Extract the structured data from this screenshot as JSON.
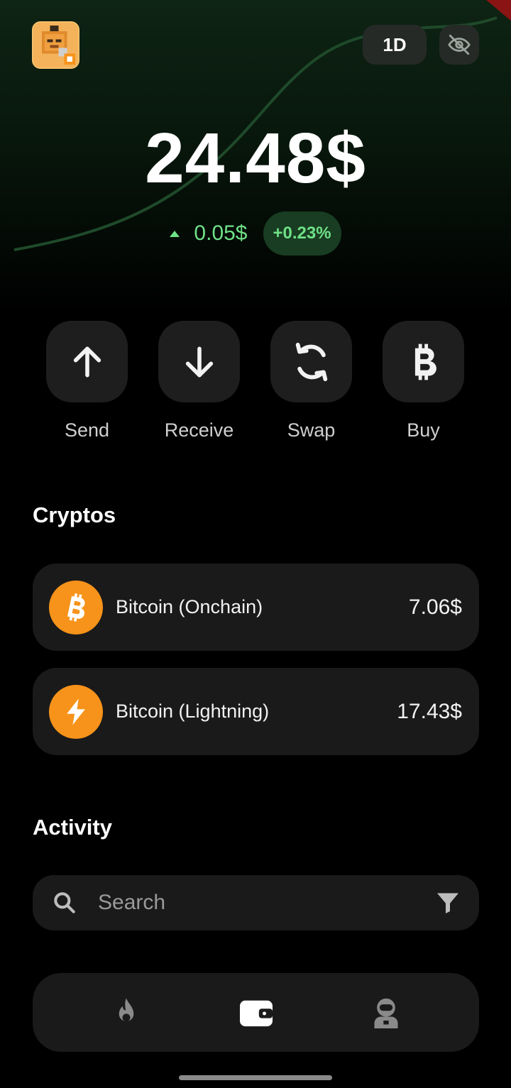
{
  "header": {
    "period_label": "1D",
    "avatar_icon": "pixel-mascot-avatar",
    "visibility_icon": "eye-off-icon"
  },
  "balance": {
    "total": "24.48$",
    "change_amount": "0.05$",
    "change_percent": "+0.23%",
    "change_direction_icon": "triangle-up-icon"
  },
  "actions": [
    {
      "label": "Send",
      "icon": "arrow-up-icon"
    },
    {
      "label": "Receive",
      "icon": "arrow-down-icon"
    },
    {
      "label": "Swap",
      "icon": "swap-icon"
    },
    {
      "label": "Buy",
      "icon": "bitcoin-icon"
    }
  ],
  "cryptos": {
    "title": "Cryptos",
    "items": [
      {
        "name": "Bitcoin (Onchain)",
        "value": "7.06$",
        "icon": "bitcoin-icon"
      },
      {
        "name": "Bitcoin (Lightning)",
        "value": "17.43$",
        "icon": "lightning-icon"
      }
    ]
  },
  "activity": {
    "title": "Activity",
    "search_placeholder": "Search"
  },
  "bottom_nav": [
    {
      "id": "fire",
      "icon": "fire-icon"
    },
    {
      "id": "wallet",
      "icon": "wallet-icon",
      "active": true
    },
    {
      "id": "profile",
      "icon": "astronaut-icon"
    }
  ],
  "colors": {
    "accent_green": "#6fe087",
    "bitcoin_orange": "#f7931a",
    "card_bg": "#1a1a1a"
  }
}
